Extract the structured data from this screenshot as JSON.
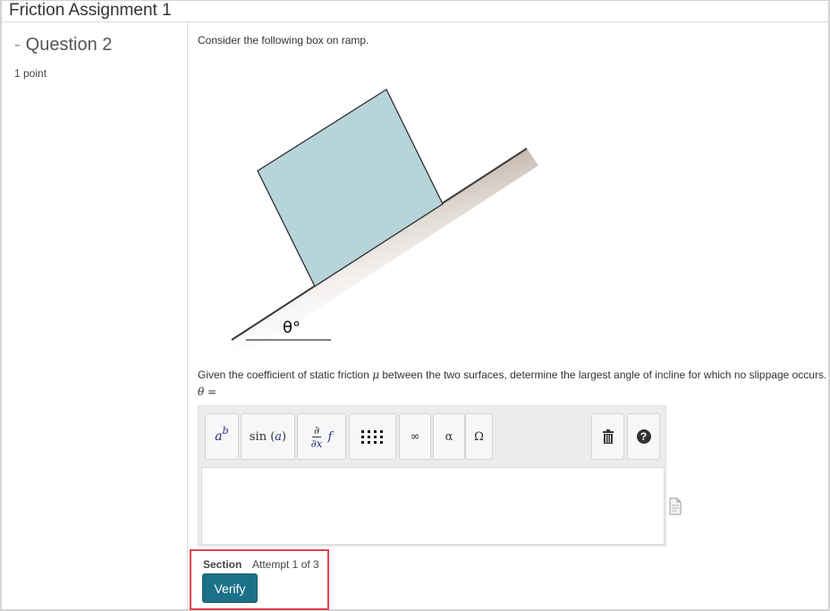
{
  "assignment": {
    "title": "Friction Assignment 1"
  },
  "question": {
    "dash": "-",
    "title": "Question 2",
    "points": "1 point",
    "prompt": "Consider the following box on ramp.",
    "figure": {
      "angle_label": "θ°"
    },
    "text_before": "Given the coefficient of static friction ",
    "mu_symbol": "μ",
    "text_after": " between the two surfaces, determine the largest angle of incline for which no slippage occurs.",
    "answer_label": "θ ="
  },
  "editor": {
    "toolbar": {
      "power": {
        "base": "a",
        "exponent": "b"
      },
      "sin": {
        "fn": "sin",
        "arg": "a"
      },
      "derivative": {
        "numerator": "∂",
        "denominator": "∂x",
        "fn": "f"
      },
      "infinity": "∞",
      "alpha": "α",
      "omega": "Ω",
      "help": "?"
    },
    "answer_value": ""
  },
  "section": {
    "label": "Section",
    "attempt": "Attempt 1 of 3",
    "verify_label": "Verify"
  },
  "colors": {
    "box_fill": "#b8d4db",
    "verify_bg": "#1c7189",
    "highlight_border": "#e0444d"
  }
}
